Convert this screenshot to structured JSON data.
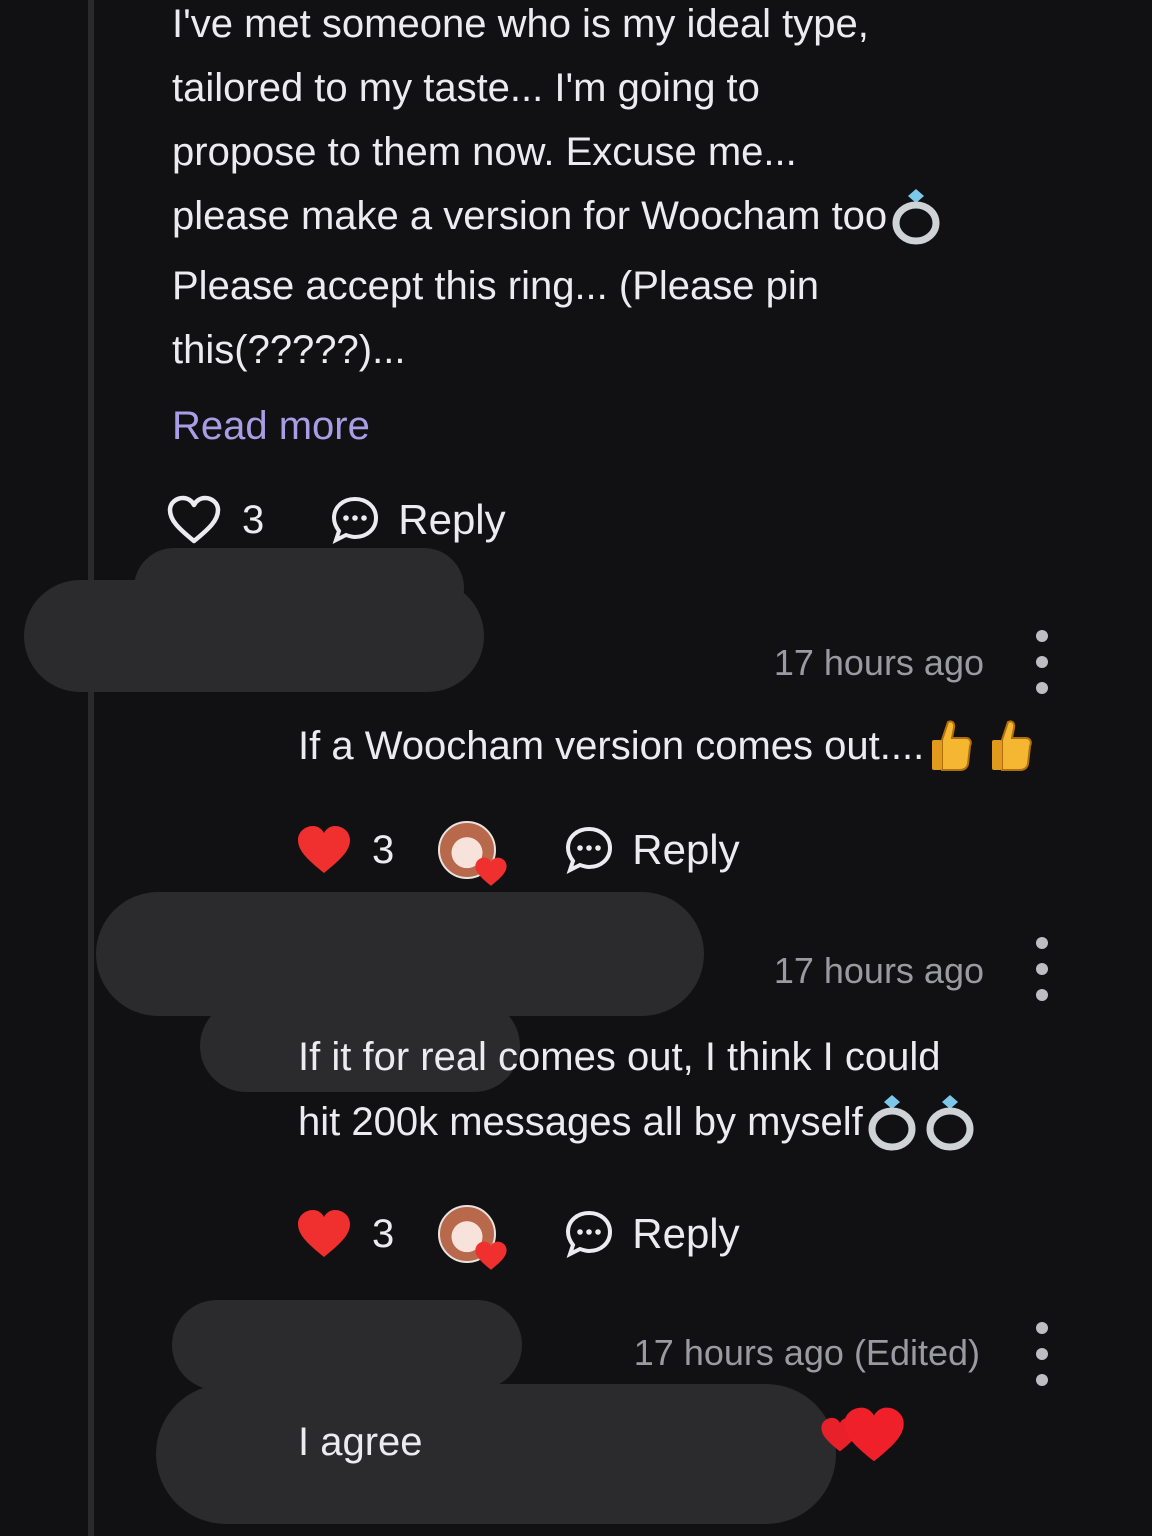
{
  "post": {
    "lines": [
      "I've met someone who is my ideal type,",
      "tailored to my taste... I'm going to",
      "propose to them now. Excuse me...",
      "please make a version for Woocham too",
      "Please accept this ring... (Please pin",
      "this(?????)..."
    ],
    "read_more": "Read more",
    "like_count": "3",
    "reply_label": "Reply"
  },
  "replies": [
    {
      "timestamp": "17 hours ago",
      "text_lines": [
        "If a  Woocham  version comes out...."
      ],
      "like_count": "3",
      "reply_label": "Reply",
      "emojis": [
        "thumbs-up",
        "thumbs-up"
      ]
    },
    {
      "timestamp": "17 hours ago",
      "text_lines": [
        "If it for real comes out, I think I could",
        "hit 200k messages all by myself"
      ],
      "like_count": "3",
      "reply_label": "Reply",
      "emojis": [
        "ring",
        "ring"
      ]
    },
    {
      "timestamp": "17 hours ago (Edited)",
      "text_lines": [
        "I agree"
      ],
      "emojis": [
        "heart",
        "heart"
      ]
    }
  ],
  "colors": {
    "background": "#111113",
    "text": "#ececf0",
    "muted": "#9a9aa2",
    "link": "#a99ee6",
    "liked": "#f0302e",
    "redaction": "#2b2b2d"
  }
}
